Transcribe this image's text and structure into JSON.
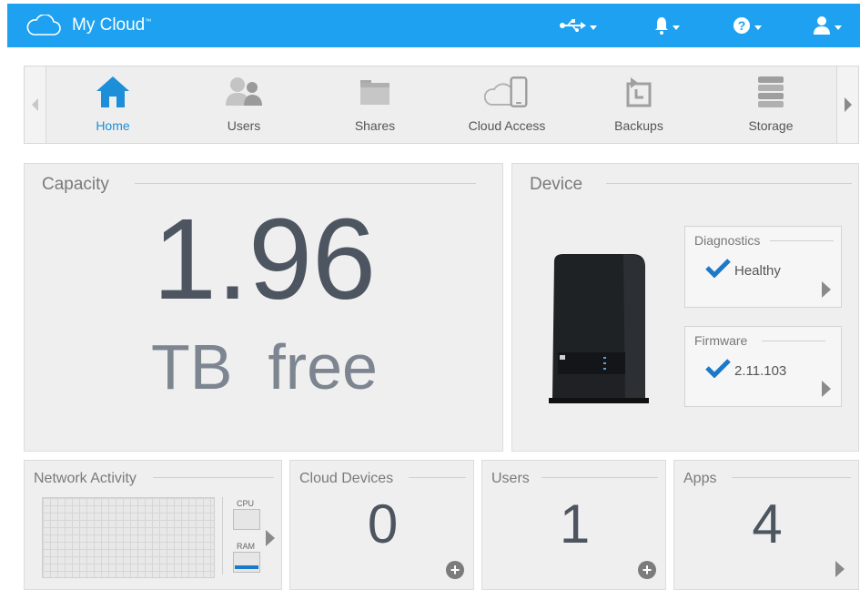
{
  "header": {
    "brand": "My Cloud",
    "trademark": "™",
    "icons": [
      "cloud-icon",
      "usb-icon",
      "bell-icon",
      "help-icon",
      "user-icon"
    ]
  },
  "nav": {
    "items": [
      {
        "label": "Home",
        "icon": "home-icon"
      },
      {
        "label": "Users",
        "icon": "users-icon"
      },
      {
        "label": "Shares",
        "icon": "folder-icon"
      },
      {
        "label": "Cloud Access",
        "icon": "cloud-access-icon"
      },
      {
        "label": "Backups",
        "icon": "backup-icon"
      },
      {
        "label": "Storage",
        "icon": "storage-icon"
      }
    ],
    "active": "Home"
  },
  "capacity": {
    "title": "Capacity",
    "value": "1.96",
    "unit": "TB  free"
  },
  "device": {
    "title": "Device",
    "diagnostics": {
      "title": "Diagnostics",
      "status": "Healthy"
    },
    "firmware": {
      "title": "Firmware",
      "version": "2.11.103"
    }
  },
  "network": {
    "title": "Network Activity",
    "cpu_label": "CPU",
    "ram_label": "RAM"
  },
  "cloud_devices": {
    "title": "Cloud Devices",
    "count": "0"
  },
  "users": {
    "title": "Users",
    "count": "1"
  },
  "apps": {
    "title": "Apps",
    "count": "4"
  },
  "colors": {
    "accent": "#1da1f0",
    "active_nav": "#1d8fd8",
    "check": "#1a79c9"
  }
}
